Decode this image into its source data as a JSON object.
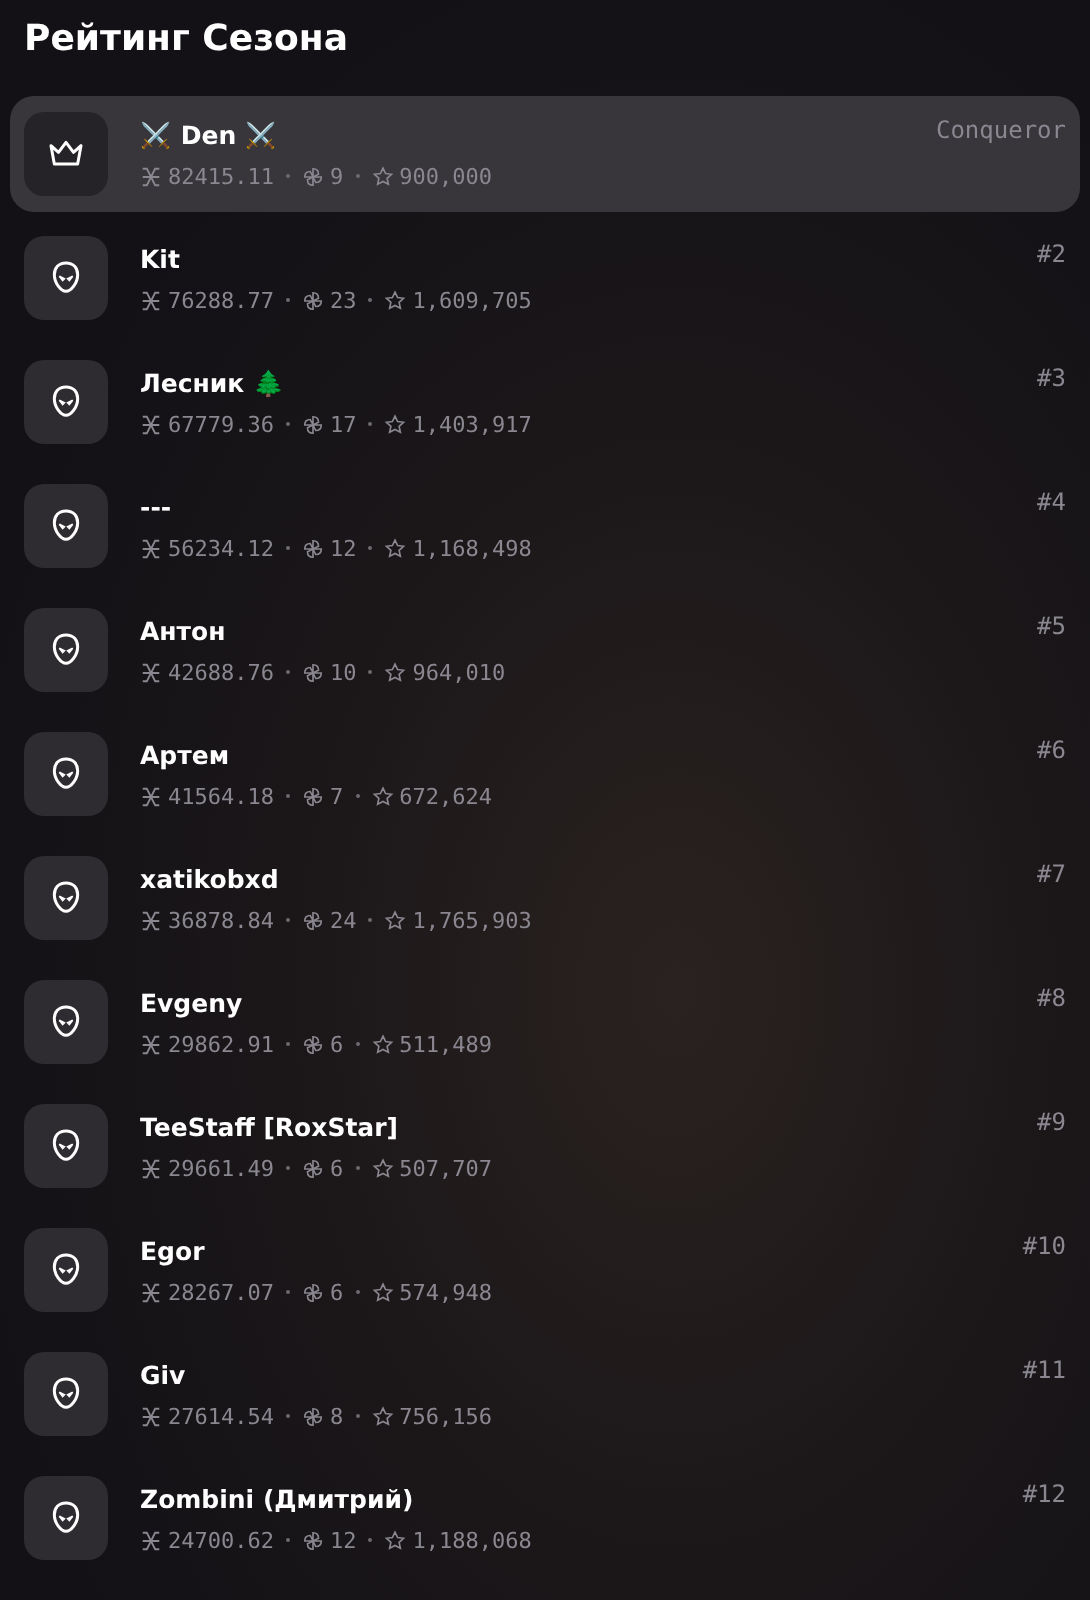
{
  "title": "Рейтинг Сезона",
  "players": [
    {
      "name": "⚔️ Den ⚔️",
      "kind": "crown",
      "selected": true,
      "score": "82415.11",
      "wins": "9",
      "stars_total": "900,000",
      "rank": "Conqueror"
    },
    {
      "name": "Kit",
      "kind": "alien",
      "selected": false,
      "score": "76288.77",
      "wins": "23",
      "stars_total": "1,609,705",
      "rank": "#2"
    },
    {
      "name": "Лесник 🌲",
      "kind": "alien",
      "selected": false,
      "score": "67779.36",
      "wins": "17",
      "stars_total": "1,403,917",
      "rank": "#3"
    },
    {
      "name": "---",
      "kind": "alien",
      "selected": false,
      "score": "56234.12",
      "wins": "12",
      "stars_total": "1,168,498",
      "rank": "#4"
    },
    {
      "name": "Антон",
      "kind": "alien",
      "selected": false,
      "score": "42688.76",
      "wins": "10",
      "stars_total": "964,010",
      "rank": "#5"
    },
    {
      "name": "Артем",
      "kind": "alien",
      "selected": false,
      "score": "41564.18",
      "wins": "7",
      "stars_total": "672,624",
      "rank": "#6"
    },
    {
      "name": "xatikobxd",
      "kind": "alien",
      "selected": false,
      "score": "36878.84",
      "wins": "24",
      "stars_total": "1,765,903",
      "rank": "#7"
    },
    {
      "name": "Evgeny",
      "kind": "alien",
      "selected": false,
      "score": "29862.91",
      "wins": "6",
      "stars_total": "511,489",
      "rank": "#8"
    },
    {
      "name": "TeeStaff [RoxStar]",
      "kind": "alien",
      "selected": false,
      "score": "29661.49",
      "wins": "6",
      "stars_total": "507,707",
      "rank": "#9"
    },
    {
      "name": "Egor",
      "kind": "alien",
      "selected": false,
      "score": "28267.07",
      "wins": "6",
      "stars_total": "574,948",
      "rank": "#10"
    },
    {
      "name": "Giv",
      "kind": "alien",
      "selected": false,
      "score": "27614.54",
      "wins": "8",
      "stars_total": "756,156",
      "rank": "#11"
    },
    {
      "name": "Zombini (Дмитрий)",
      "kind": "alien",
      "selected": false,
      "score": "24700.62",
      "wins": "12",
      "stars_total": "1,188,068",
      "rank": "#12"
    }
  ]
}
